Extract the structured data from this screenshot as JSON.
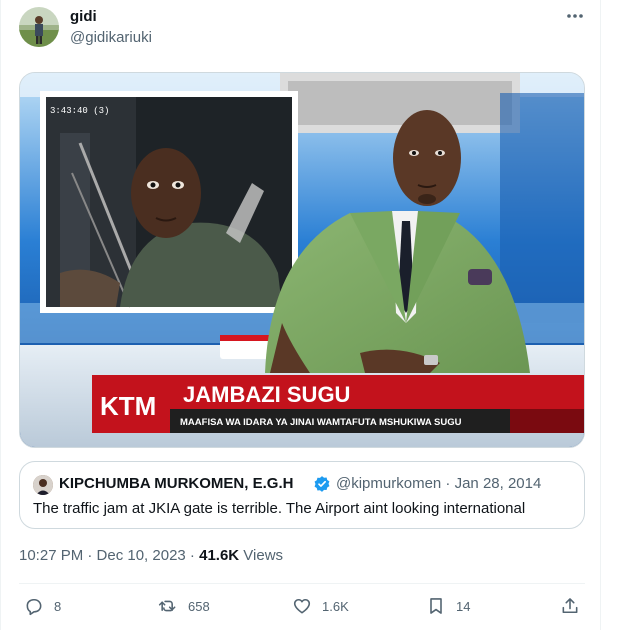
{
  "tweet": {
    "author": {
      "name": "gidi",
      "handle": "@gidikariuki"
    },
    "more_icon": "more-horizontal-icon",
    "media": {
      "camera_timestamp": "3:43:40 (3)",
      "chyron_logo": "KTM",
      "chyron_headline": "JAMBAZI SUGU",
      "chyron_subline": "MAAFISA WA IDARA YA JINAI WAMTAFUTA MSHUKIWA SUGU"
    },
    "quote": {
      "author_name": "KIPCHUMBA MURKOMEN, E.G.H",
      "verified_icon": "verified-badge-icon",
      "handle_date": "@kipmurkomen · Jan 28, 2014",
      "text": "The traffic jam at JKIA gate is terrible. The Airport aint looking international"
    },
    "meta": {
      "time_date": "10:27 PM · Dec 10, 2023 · ",
      "views_count": "41.6K",
      "views_label": " Views"
    },
    "actions": {
      "reply": {
        "icon": "reply-icon",
        "count": "8"
      },
      "retweet": {
        "icon": "retweet-icon",
        "count": "658"
      },
      "like": {
        "icon": "heart-icon",
        "count": "1.6K"
      },
      "bookmark": {
        "icon": "bookmark-icon",
        "count": "14"
      },
      "share": {
        "icon": "share-icon"
      }
    }
  },
  "colors": {
    "brand_blue": "#1d9bf0",
    "chyron_red": "#c3121c",
    "chyron_dark": "#1c1c1c",
    "suit_green": "#7aa862",
    "text_primary": "#0f1419",
    "text_secondary": "#536471"
  }
}
